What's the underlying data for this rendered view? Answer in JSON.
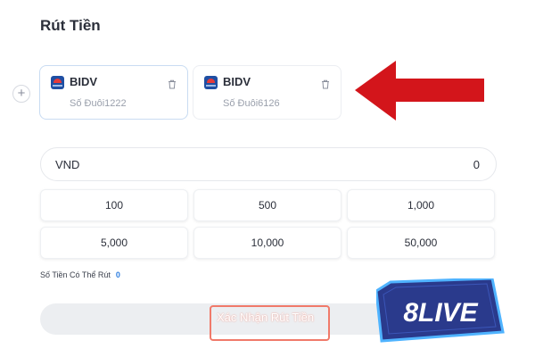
{
  "page": {
    "title": "Rút Tiền"
  },
  "banks": [
    {
      "name": "BIDV",
      "account": "Số Đuôi1222",
      "logo_icon": "bidv-logo-icon",
      "action_icon": "trash-icon",
      "selected": true
    },
    {
      "name": "BIDV",
      "account": "Số Đuôi6126",
      "logo_icon": "bidv-logo-icon",
      "action_icon": "trash-icon",
      "selected": false
    }
  ],
  "add_button": {
    "label": "+"
  },
  "amount": {
    "currency": "VND",
    "value": "0"
  },
  "presets": [
    "100",
    "500",
    "1,000",
    "5,000",
    "10,000",
    "50,000"
  ],
  "available": {
    "label": "Số Tiền Có Thể Rút",
    "value": "0"
  },
  "submit": {
    "label": "Xác Nhận Rút Tiền"
  },
  "brand_logo": {
    "text": "8LIVE"
  },
  "colors": {
    "arrow": "#d3151b",
    "accent": "#2f7fe0",
    "highlight": "#f07a6a",
    "logo_bg": "#2a3a8c",
    "logo_border": "#4fb3ff"
  }
}
